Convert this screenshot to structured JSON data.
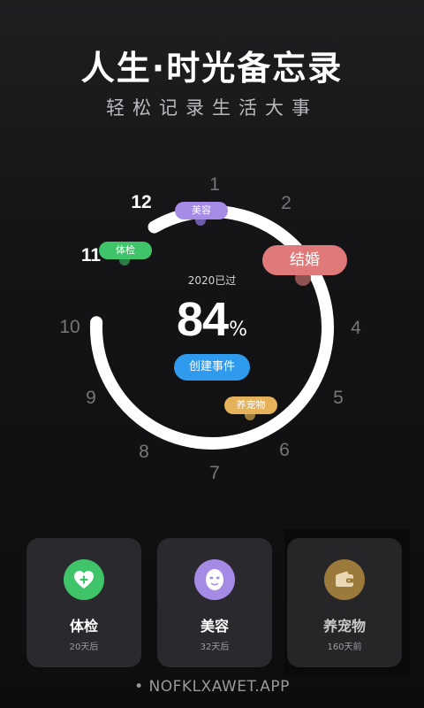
{
  "header": {
    "title": "人生·时光备忘录",
    "subtitle": "轻松记录生活大事"
  },
  "dial": {
    "hours": [
      "1",
      "2",
      "4",
      "5",
      "6",
      "7",
      "8",
      "9",
      "10",
      "11",
      "12"
    ],
    "progress_label": "2020已过",
    "progress_value": "84",
    "progress_unit": "%",
    "progress_fraction": 0.84,
    "create_button": "创建事件",
    "events": [
      {
        "label": "美容",
        "color": "#a58ae6"
      },
      {
        "label": "结婚",
        "color": "#e07a7a"
      },
      {
        "label": "体检",
        "color": "#3fc46a"
      },
      {
        "label": "养宠物",
        "color": "#e5b25a"
      }
    ]
  },
  "cards": [
    {
      "name": "体检",
      "sub": "20天后",
      "icon": "heart-plus-icon",
      "color": "#3fc46a"
    },
    {
      "name": "美容",
      "sub": "32天后",
      "icon": "face-mask-icon",
      "color": "#a58ae6"
    },
    {
      "name": "养宠物",
      "sub": "160天前",
      "icon": "wallet-icon",
      "color": "#9c7a3c"
    }
  ],
  "footer": "• NOFKLXAWET.APP"
}
